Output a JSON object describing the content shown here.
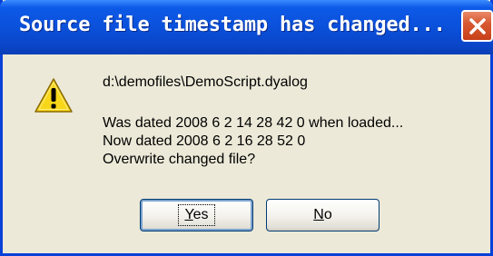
{
  "window": {
    "title": "Source file timestamp has changed...",
    "close_icon": "close-icon"
  },
  "dialog": {
    "icon": "warning-icon",
    "file_path": "d:\\demofiles\\DemoScript.dyalog",
    "lines": [
      "Was dated  2008 6 2 14 28 42 0  when loaded...",
      "Now dated  2008 6 2 16 28 52 0",
      "Overwrite changed file?"
    ]
  },
  "buttons": {
    "yes": {
      "accel": "Y",
      "rest": "es"
    },
    "no": {
      "accel": "N",
      "rest": "o"
    }
  },
  "colors": {
    "titlebar": "#0a4fd8",
    "dialog_bg": "#ece9d8",
    "close_button": "#d85a32",
    "warning_fill": "#f8d61a"
  }
}
